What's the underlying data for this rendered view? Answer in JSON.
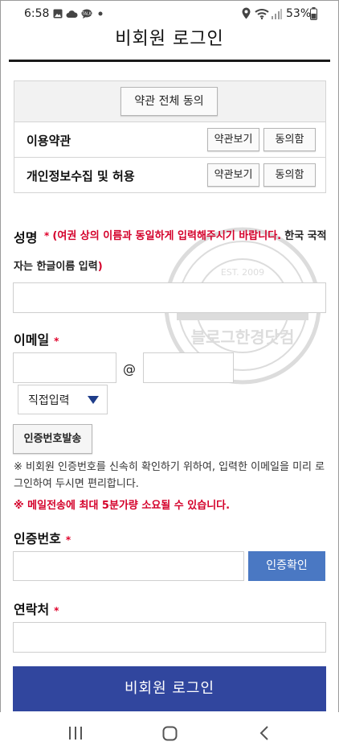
{
  "status_bar": {
    "time": "6:58",
    "battery_percent": "53%",
    "left_icons": [
      "image-icon",
      "cloud-icon",
      "talk-icon",
      "dot-icon"
    ],
    "right_icons": [
      "location-icon",
      "wifi-icon",
      "signal-icon",
      "battery-icon"
    ]
  },
  "header": {
    "title": "비회원 로그인"
  },
  "terms": {
    "agree_all_label": "약관 전체 동의",
    "rows": [
      {
        "label": "이용약관",
        "view_label": "약관보기",
        "agree_label": "동의함"
      },
      {
        "label": "개인정보수집 및 허용",
        "view_label": "약관보기",
        "agree_label": "동의함"
      }
    ]
  },
  "form": {
    "name_label": "성명",
    "required_mark": "*",
    "name_note_red": "(여권 상의 이름과 동일하게 입력해주시기 바랍니다.",
    "name_note_black_1": "한국 국적",
    "name_note_black_2": "자는 한글이름 입력",
    "name_note_red_close": ")",
    "name_value": "",
    "email_label": "이메일",
    "email_local_value": "",
    "email_at": "@",
    "email_domain_value": "",
    "email_domain_select": "직접입력",
    "send_code_label": "인증번호발송",
    "notice_1": "※ 비회원 인증번호를 신속히 확인하기 위하여, 입력한 이메일을 미리 로그인하여 두시면 편리합니다.",
    "notice_2": "※ 메일전송에 최대 5분가량 소요될 수 있습니다.",
    "code_label": "인증번호",
    "code_value": "",
    "confirm_label": "인증확인",
    "phone_label": "연락처",
    "phone_value": "",
    "submit_label": "비회원 로그인"
  },
  "watermark": {
    "text_center": "블로그한경닷컴",
    "text_top": "EST. 2009",
    "text_ring": "블로그한경닷컴"
  },
  "nav_bar": {
    "icons": [
      "recent-apps-icon",
      "home-icon",
      "back-icon"
    ]
  },
  "colors": {
    "required": "#e0002a",
    "warning_text": "#d4002a",
    "confirm_button": "#4a78c3",
    "submit_button": "#31469e",
    "select_arrow": "#1f3d8a",
    "title_rule": "#1a1a1a"
  }
}
